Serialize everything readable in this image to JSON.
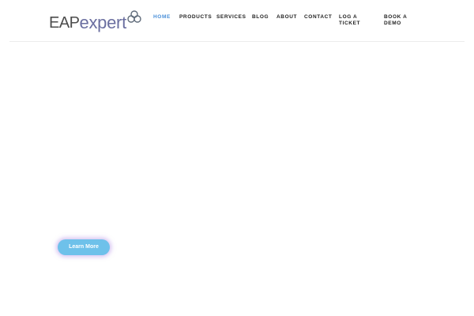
{
  "brand": {
    "logo_part1": "EAP",
    "logo_part2": "expert",
    "logo_mark_icon": "three-circles-logo-icon",
    "colors": {
      "logo_dark": "#4d4d4d",
      "logo_accent": "#6b6fa0",
      "nav_active": "#4a90d9",
      "nav_default": "#222222",
      "button_bg": "#6ec1ea",
      "button_glow": "#af8ce6"
    }
  },
  "nav": {
    "items": [
      {
        "label": "HOME",
        "active": true
      },
      {
        "label": "PRODUCTS",
        "active": false
      },
      {
        "label": "SERVICES",
        "active": false
      },
      {
        "label": "BLOG",
        "active": false
      },
      {
        "label": "ABOUT",
        "active": false
      },
      {
        "label": "CONTACT",
        "active": false
      },
      {
        "label": "LOG A TICKET",
        "active": false
      },
      {
        "label": "BOOK A DEMO",
        "active": false
      }
    ]
  },
  "hero": {
    "cta_label": "Learn More"
  }
}
